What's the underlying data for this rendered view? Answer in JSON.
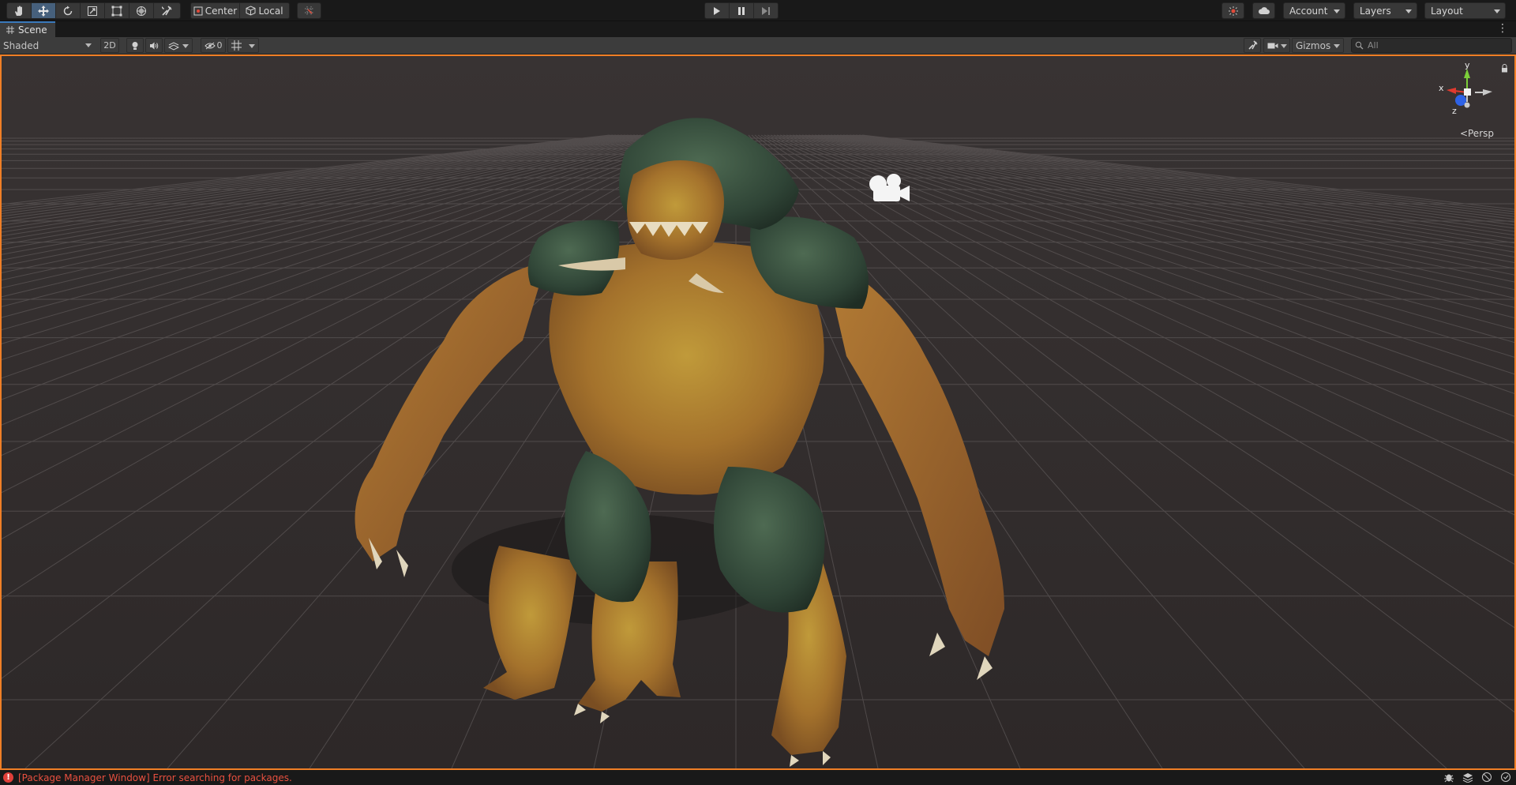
{
  "toolbar": {
    "pivot_mode": "Center",
    "pivot_rotation": "Local",
    "account": "Account",
    "layers": "Layers",
    "layout": "Layout"
  },
  "scene_tab": {
    "title": "Scene"
  },
  "scene_toolbar": {
    "draw_mode": "Shaded",
    "mode_2d": "2D",
    "hidden_count": "0",
    "gizmos": "Gizmos",
    "search_placeholder": "All"
  },
  "scene_view": {
    "projection": "Persp",
    "axis_labels": {
      "x": "x",
      "y": "y",
      "z": "z"
    }
  },
  "status_bar": {
    "message": "[Package Manager Window] Error searching for packages."
  },
  "colors": {
    "accent_selected": "#46607c",
    "scene_border": "#f07f26",
    "error": "#e8503f",
    "axis_x": "#e03a2f",
    "axis_y": "#7ccf3a",
    "axis_z": "#2e62e6"
  }
}
